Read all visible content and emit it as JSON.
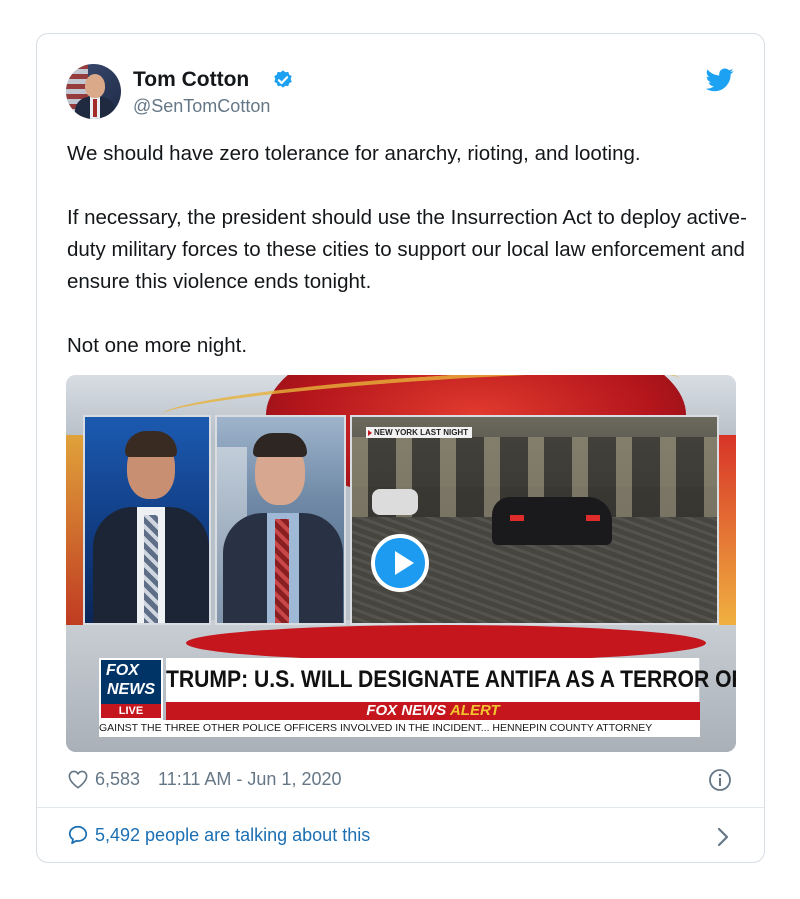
{
  "tweet": {
    "author_name": "Tom Cotton",
    "author_handle": "@SenTomCotton",
    "paragraphs": [
      "We should have zero tolerance for anarchy, rioting, and looting.",
      "If necessary, the president should use the Insurrection Act to deploy active-duty military forces to these cities to support our local law enforcement and ensure this violence ends tonight.",
      "Not one more night."
    ],
    "likes": "6,583",
    "timestamp": "11:11 AM - Jun 1, 2020",
    "talking": "5,492 people are talking about this"
  },
  "video": {
    "location_label": "NEW YORK LAST NIGHT",
    "network_line1": "FOX",
    "network_line2": "NEWS",
    "live_label": "LIVE",
    "headline": "TRUMP: U.S. WILL DESIGNATE ANTIFA AS A TERROR ORG",
    "alert_prefix": "FOX NEWS",
    "alert_word": "ALERT",
    "ticker": "GAINST THE THREE OTHER POLICE OFFICERS INVOLVED IN THE INCIDENT...   HENNEPIN COUNTY ATTORNEY"
  },
  "icons": {
    "verified": "verified-badge-icon",
    "brand": "twitter-bird-icon",
    "like": "heart-icon",
    "info": "info-icon",
    "comment": "speech-bubble-icon",
    "next": "chevron-right-icon",
    "play": "play-icon"
  },
  "colors": {
    "twitter_blue": "#1da1f2",
    "link_blue": "#1b6fb3",
    "muted_text": "#657786",
    "fox_red": "#c4161c",
    "fox_navy": "#003366"
  }
}
